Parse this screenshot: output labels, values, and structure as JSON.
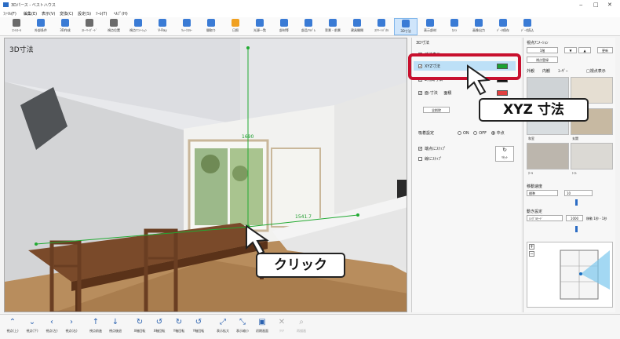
{
  "window": {
    "title": "3Dパース - ベストハウス",
    "controls": [
      "‒",
      "□",
      "✕"
    ]
  },
  "menu": [
    "ﾌｧｲﾙ(F)",
    "編集(E)",
    "表示(V)",
    "変換(C)",
    "設定(S)",
    "ﾂｰﾙ(T)",
    "ﾍﾙﾌﾟ(H)"
  ],
  "ribbon": [
    {
      "label": "ｺﾝﾄﾛｰﾙ",
      "color": "#6b6b6b"
    },
    {
      "label": "外部条件",
      "color": "#3a7bd5"
    },
    {
      "label": "3D作成",
      "color": "#3a7bd5"
    },
    {
      "label": "ｽﾄｰﾘｰﾎﾞｰﾄﾞ",
      "color": "#6b6b6b"
    },
    {
      "label": "視点位置",
      "color": "#6b6b6b"
    },
    {
      "label": "視点ｱﾆﾒｰｼｮﾝ",
      "color": "#3a7bd5"
    },
    {
      "label": "V-Ray",
      "color": "#3a7bd5"
    },
    {
      "label": "ｳｫｰｸｽﾙｰ",
      "color": "#3a7bd5"
    },
    {
      "label": "間取り",
      "color": "#3a7bd5"
    },
    {
      "label": "日照",
      "color": "#f0a020"
    },
    {
      "label": "光源一覧",
      "color": "#3a7bd5"
    },
    {
      "label": "部材等",
      "color": "#3a7bd5"
    },
    {
      "label": "部品ｱﾙﾊﾞﾑ",
      "color": "#3a7bd5"
    },
    {
      "label": "背景・前景",
      "color": "#3a7bd5"
    },
    {
      "label": "建具開閉",
      "color": "#3a7bd5"
    },
    {
      "label": "ｽｸﾘｰﾝﾊﾟﾈﾙ",
      "color": "#3a7bd5"
    },
    {
      "label": "3D寸法",
      "color": "#3a7bd5"
    },
    {
      "label": "表示部材",
      "color": "#3a7bd5"
    },
    {
      "label": "ｶﾒﾗ",
      "color": "#3a7bd5"
    },
    {
      "label": "画像出力",
      "color": "#3a7bd5"
    },
    {
      "label": "ﾃﾞｰﾀ保存",
      "color": "#3a7bd5"
    },
    {
      "label": "ﾃﾞｰﾀ読込",
      "color": "#3a7bd5"
    }
  ],
  "viewport": {
    "title": "3D寸法",
    "dim_vertical": "1690",
    "dim_horizontal": "1541.7"
  },
  "dimension_panel": {
    "title": "3D寸法",
    "show_dims_label": "寸法表示",
    "xyz_label": "XYZ寸法",
    "xyz_color": "#1aa232",
    "two_point_label": "2点間寸法",
    "two_point_color": "#111111",
    "surface_label": "面-寸法",
    "surface_color": "#e04040",
    "surface_option": "面積",
    "delete_all_label": "全削除",
    "snap_title": "吸着設定",
    "radio_options": [
      "ON",
      "OFF",
      "中点"
    ],
    "snap_vertex_label": "端点にｽﾅｯﾌﾟ",
    "snap_line_label": "線にｽﾅｯﾌﾟ",
    "reset_label": "ﾘｾｯﾄ"
  },
  "right_panel": {
    "title": "視点ｱﾆﾒｰｼｮﾝ",
    "field1": "1階",
    "field2": "視点登録",
    "tab_labels": [
      "外観",
      "内観",
      "ﾕｰｻﾞｰ",
      "□視点表示"
    ],
    "button_top_right": "更新",
    "thumbs": [
      "",
      "",
      "",
      "和室",
      "玄関",
      "ﾎｰﾙ",
      "ﾄｲﾚ"
    ],
    "speed_label": "移動速度",
    "speed_select": "標準",
    "speed_value": "10",
    "anim_label": "動き設定",
    "anim_select": "ｼﾝｸﾞﾙﾓｰﾄﾞ",
    "anim_value": "1000",
    "anim_unit": "移動 1秒 - 1秒"
  },
  "bottom": [
    {
      "glyph": "⌃",
      "label": "視点(上)"
    },
    {
      "glyph": "⌄",
      "label": "視点(下)"
    },
    {
      "glyph": "‹",
      "label": "視点(左)"
    },
    {
      "glyph": "›",
      "label": "視点(右)"
    },
    {
      "glyph": "↑",
      "label": "視点前進"
    },
    {
      "glyph": "↓",
      "label": "視点後退"
    },
    {
      "glyph": "↻",
      "label": "X軸回転"
    },
    {
      "glyph": "↺",
      "label": "X軸回転"
    },
    {
      "glyph": "↻",
      "label": "Y軸回転"
    },
    {
      "glyph": "↺",
      "label": "Y軸回転"
    },
    {
      "glyph": "⤢",
      "label": "表示拡大"
    },
    {
      "glyph": "⤡",
      "label": "表示縮小"
    },
    {
      "glyph": "▣",
      "label": "初期画面"
    },
    {
      "glyph": "✕",
      "label": "ｸﾘｱ",
      "disabled": true
    },
    {
      "glyph": "⌕",
      "label": "再描画",
      "disabled": true
    }
  ],
  "callouts": {
    "xyz": "XYZ 寸法",
    "click": "クリック"
  }
}
